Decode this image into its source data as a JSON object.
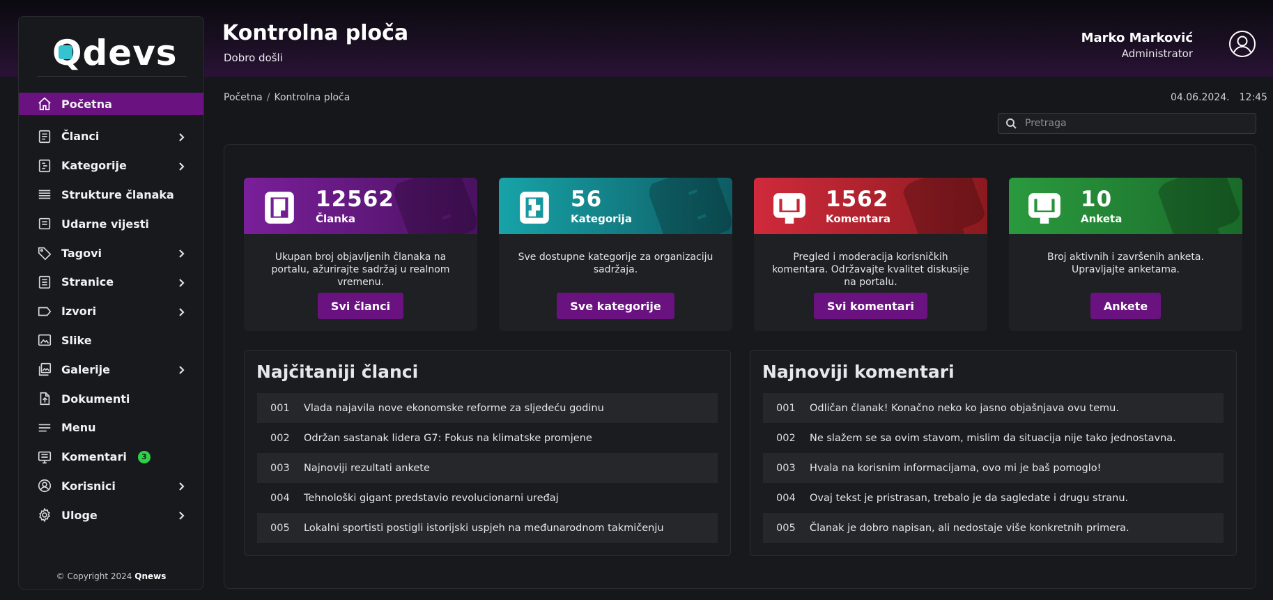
{
  "brand": {
    "logo": "Qdevs",
    "copyright_prefix": "Copyright 2024",
    "copyright_brand": "Qnews"
  },
  "header": {
    "title": "Kontrolna ploča",
    "subtitle": "Dobro došli"
  },
  "user": {
    "name": "Marko Marković",
    "role": "Administrator"
  },
  "breadcrumb": {
    "home": "Početna",
    "sep": "/",
    "current": "Kontrolna ploča"
  },
  "datetime": {
    "date": "04.06.2024.",
    "time": "12:45"
  },
  "search": {
    "placeholder": "Pretraga"
  },
  "sidebar": {
    "items": [
      {
        "label": "Početna",
        "icon": "home-icon",
        "active": true
      },
      {
        "label": "Članci",
        "icon": "article-icon",
        "chevron": true
      },
      {
        "label": "Kategorije",
        "icon": "category-icon",
        "chevron": true
      },
      {
        "label": "Strukture članaka",
        "icon": "lines-icon"
      },
      {
        "label": "Udarne vijesti",
        "icon": "news-icon"
      },
      {
        "label": "Tagovi",
        "icon": "tag-icon",
        "chevron": true
      },
      {
        "label": "Stranice",
        "icon": "page-icon",
        "chevron": true
      },
      {
        "label": "Izvori",
        "icon": "source-icon",
        "chevron": true
      },
      {
        "label": "Slike",
        "icon": "image-icon"
      },
      {
        "label": "Galerije",
        "icon": "gallery-icon",
        "chevron": true
      },
      {
        "label": "Dokumenti",
        "icon": "document-icon"
      },
      {
        "label": "Menu",
        "icon": "menu-icon"
      },
      {
        "label": "Komentari",
        "icon": "comment-icon",
        "badge": "3"
      },
      {
        "label": "Korisnici",
        "icon": "user-icon",
        "chevron": true
      },
      {
        "label": "Uloge",
        "icon": "gear-icon",
        "chevron": true
      }
    ]
  },
  "cards": [
    {
      "number": "12562",
      "label": "Članka",
      "desc": "Ukupan broj objavljenih članaka na portalu, ažurirajte sadržaj u realnom vremenu.",
      "button": "Svi članci",
      "color_from": "#7a1f9a",
      "color_to": "#4a1260",
      "icon": "article-icon"
    },
    {
      "number": "56",
      "label": "Kategorija",
      "desc": "Sve dostupne kategorije za organizaciju sadržaja.",
      "button": "Sve kategorije",
      "color_from": "#17a3a8",
      "color_to": "#0e5c63",
      "icon": "category-icon"
    },
    {
      "number": "1562",
      "label": "Komentara",
      "desc": "Pregled i moderacija korisničkih komentara. Održavajte kvalitet diskusije na portalu.",
      "button": "Svi komentari",
      "color_from": "#d02a3c",
      "color_to": "#8a1a1e",
      "icon": "comment-icon"
    },
    {
      "number": "10",
      "label": "Anketa",
      "desc": "Broj aktivnih i završenih anketa. Upravljajte anketama.",
      "button": "Ankete",
      "color_from": "#2a9a3e",
      "color_to": "#1a6a2a",
      "icon": "poll-icon"
    }
  ],
  "popular": {
    "title": "Najčitaniji članci",
    "rows": [
      {
        "n": "001",
        "text": "Vlada najavila nove ekonomske reforme za sljedeću godinu"
      },
      {
        "n": "002",
        "text": "Održan sastanak lidera G7: Fokus na klimatske promjene"
      },
      {
        "n": "003",
        "text": "Najnoviji rezultati ankete"
      },
      {
        "n": "004",
        "text": "Tehnološki gigant predstavio revolucionarni uređaj"
      },
      {
        "n": "005",
        "text": "Lokalni sportisti postigli istorijski uspjeh na međunarodnom takmičenju"
      }
    ]
  },
  "comments": {
    "title": "Najnoviji komentari",
    "rows": [
      {
        "n": "001",
        "text": "Odličan članak! Konačno neko ko jasno objašnjava ovu temu."
      },
      {
        "n": "002",
        "text": "Ne slažem se sa ovim stavom, mislim da situacija nije tako jednostavna."
      },
      {
        "n": "003",
        "text": "Hvala na korisnim informacijama, ovo mi je baš pomoglo!"
      },
      {
        "n": "004",
        "text": "Ovaj tekst je pristrasan, trebalo je da sagledate i drugu stranu."
      },
      {
        "n": "005",
        "text": "Članak je dobro napisan, ali nedostaje više konkretnih primera."
      }
    ]
  }
}
